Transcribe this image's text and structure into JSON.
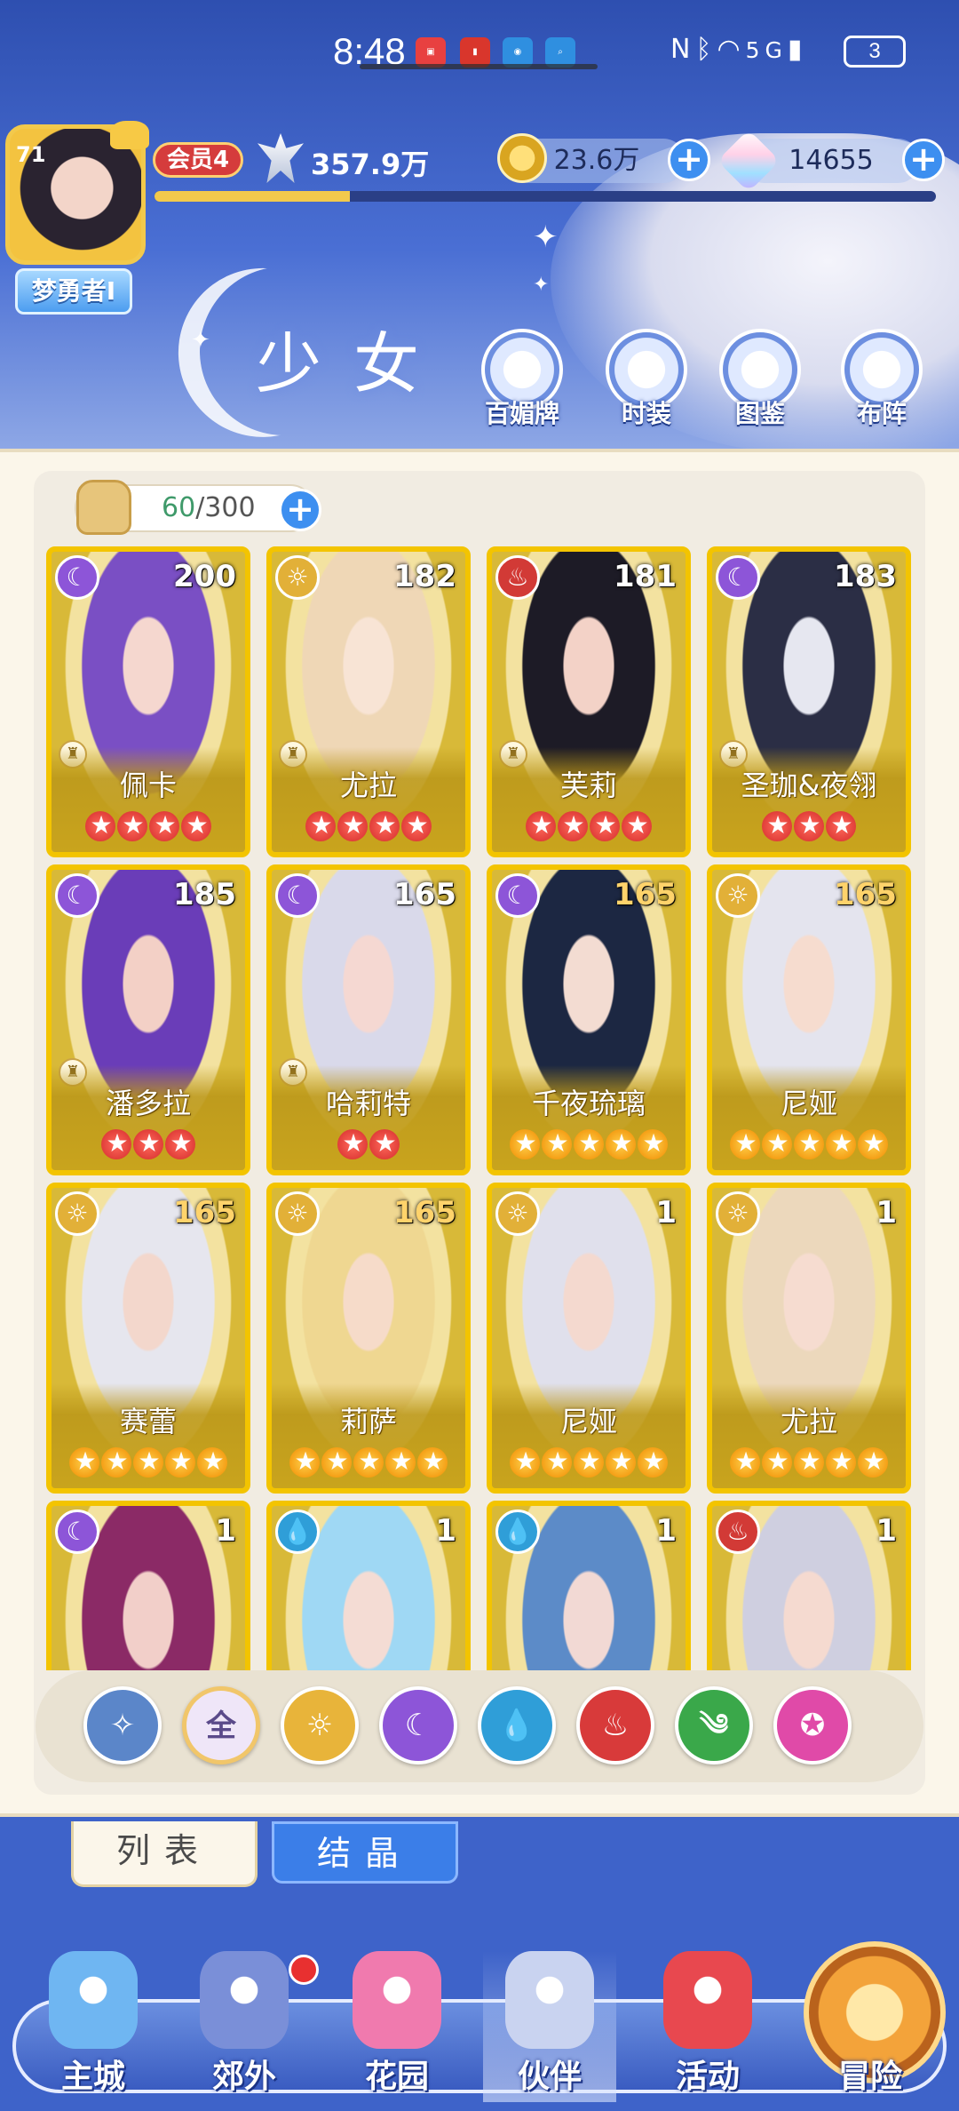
{
  "status_bar": {
    "time": "8:48",
    "battery": "3",
    "network": "5G",
    "icons": [
      "huawei-app-icon",
      "red-app-icon",
      "browser-icon",
      "search-app-icon",
      "nfc-icon",
      "bluetooth-icon",
      "wifi-icon",
      "signal-icon"
    ]
  },
  "player": {
    "level": "71",
    "name": "梦勇者I",
    "vip": "会员4",
    "power": "357.9万",
    "exp_fraction": 0.25,
    "gold": "23.6万",
    "crystals": "14655"
  },
  "page": {
    "title": "少女",
    "buttons": [
      {
        "label": "百媚牌",
        "icon": "card-deck-icon"
      },
      {
        "label": "时装",
        "icon": "outfit-icon"
      },
      {
        "label": "图鉴",
        "icon": "book-icon"
      },
      {
        "label": "布阵",
        "icon": "formation-grid-icon"
      }
    ]
  },
  "roster": {
    "current": "60",
    "max": "/300",
    "cards": [
      {
        "name": "佩卡",
        "level": "200",
        "attr": "moon",
        "stars": 4,
        "star_color": "red",
        "role": true
      },
      {
        "name": "尤拉",
        "level": "182",
        "attr": "sun",
        "stars": 4,
        "star_color": "red",
        "role": true
      },
      {
        "name": "芙莉",
        "level": "181",
        "attr": "fire",
        "stars": 4,
        "star_color": "red",
        "role": true
      },
      {
        "name": "圣珈&夜翎",
        "level": "183",
        "attr": "moon",
        "stars": 3,
        "star_color": "red",
        "role": true
      },
      {
        "name": "潘多拉",
        "level": "185",
        "attr": "moon",
        "stars": 3,
        "star_color": "red",
        "role": true
      },
      {
        "name": "哈莉特",
        "level": "165",
        "attr": "moon",
        "stars": 2,
        "star_color": "red",
        "role": true
      },
      {
        "name": "千夜琉璃",
        "level": "165",
        "attr": "moon",
        "stars": 5,
        "star_color": "orange",
        "role": false,
        "gold_level": true
      },
      {
        "name": "尼娅",
        "level": "165",
        "attr": "sun",
        "stars": 5,
        "star_color": "orange",
        "role": false,
        "gold_level": true
      },
      {
        "name": "赛蕾",
        "level": "165",
        "attr": "sun",
        "stars": 5,
        "star_color": "orange",
        "role": false,
        "gold_level": true
      },
      {
        "name": "莉萨",
        "level": "165",
        "attr": "sun",
        "stars": 5,
        "star_color": "orange",
        "role": false,
        "gold_level": true
      },
      {
        "name": "尼娅",
        "level": "1",
        "attr": "sun",
        "stars": 5,
        "star_color": "orange",
        "role": false
      },
      {
        "name": "尤拉",
        "level": "1",
        "attr": "sun",
        "stars": 5,
        "star_color": "orange",
        "role": false
      },
      {
        "name": "",
        "level": "1",
        "attr": "moon",
        "stars": 0,
        "star_color": "orange",
        "role": false
      },
      {
        "name": "",
        "level": "1",
        "attr": "water",
        "stars": 0,
        "star_color": "orange",
        "role": false
      },
      {
        "name": "",
        "level": "1",
        "attr": "water",
        "stars": 0,
        "star_color": "orange",
        "role": false
      },
      {
        "name": "",
        "level": "1",
        "attr": "fire",
        "stars": 0,
        "star_color": "orange",
        "role": false
      }
    ]
  },
  "filters": [
    {
      "label": "",
      "icon": "collapse-up-icon",
      "color": "#5b86c9"
    },
    {
      "label": "全",
      "icon": "all-filter-icon",
      "color": "#efe6f8",
      "selected": true
    },
    {
      "label": "",
      "icon": "sun-element-icon",
      "color": "#e8b43a"
    },
    {
      "label": "",
      "icon": "moon-element-icon",
      "color": "#8d55d8"
    },
    {
      "label": "",
      "icon": "water-element-icon",
      "color": "#2f9ed8"
    },
    {
      "label": "",
      "icon": "fire-element-icon",
      "color": "#d83a3a"
    },
    {
      "label": "",
      "icon": "wind-element-icon",
      "color": "#3aa84a"
    },
    {
      "label": "",
      "icon": "star-element-icon",
      "color": "#e04aa8"
    }
  ],
  "tabs": {
    "list": "列表",
    "crystal": "结晶"
  },
  "nav": [
    {
      "label": "主城",
      "icon": "castle-icon",
      "color": "#6fb6f2"
    },
    {
      "label": "郊外",
      "icon": "portal-icon",
      "color": "#7a8fd8"
    },
    {
      "label": "花园",
      "icon": "heart-garden-icon",
      "color": "#f07aae"
    },
    {
      "label": "伙伴",
      "icon": "partner-portrait-icon",
      "color": "#c9d3f0",
      "active": true
    },
    {
      "label": "活动",
      "icon": "gift-box-icon",
      "color": "#e8484f"
    },
    {
      "label": "冒险",
      "icon": "adventure-compass-icon",
      "color": "#f0a040"
    }
  ],
  "colors": {
    "moon": "#8d55d8",
    "sun": "#e2b038",
    "fire": "#d23a36",
    "water": "#2f9ed8"
  }
}
